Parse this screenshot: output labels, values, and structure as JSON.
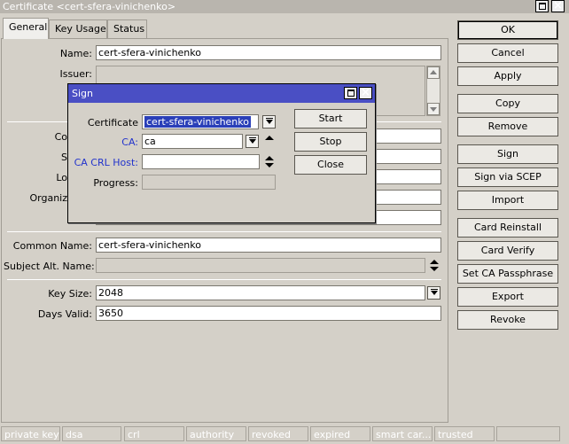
{
  "window": {
    "title": "Certificate <cert-sfera-vinichenko>"
  },
  "tabs": [
    {
      "label": "General",
      "active": true
    },
    {
      "label": "Key Usage",
      "active": false
    },
    {
      "label": "Status",
      "active": false
    }
  ],
  "form": {
    "name_label": "Name:",
    "name_value": "cert-sfera-vinichenko",
    "issuer_label": "Issuer:",
    "country_label": "Co",
    "state_label": "S",
    "locality_label": "Lo",
    "organization_label": "Organiz",
    "common_name_label": "Common Name:",
    "common_name_value": "cert-sfera-vinichenko",
    "subject_alt_label": "Subject Alt. Name:",
    "key_size_label": "Key Size:",
    "key_size_value": "2048",
    "days_valid_label": "Days Valid:",
    "days_valid_value": "3650"
  },
  "buttons": [
    "OK",
    "Cancel",
    "Apply",
    "Copy",
    "Remove",
    "Sign",
    "Sign via SCEP",
    "Import",
    "Card Reinstall",
    "Card Verify",
    "Set CA Passphrase",
    "Export",
    "Revoke"
  ],
  "status_flags": [
    "private key",
    "dsa",
    "crl",
    "authority",
    "revoked",
    "expired",
    "smart car...",
    "trusted",
    ""
  ],
  "sign_dialog": {
    "title": "Sign",
    "certificate_label": "Certificate",
    "certificate_value": "cert-sfera-vinichenko",
    "ca_label": "CA:",
    "ca_value": "ca",
    "ca_crl_host_label": "CA CRL Host:",
    "ca_crl_host_value": "",
    "progress_label": "Progress:",
    "start_label": "Start",
    "stop_label": "Stop",
    "close_label": "Close"
  },
  "colors": {
    "dialog_title_bg": "#4a4fc4",
    "blue_label": "#2233cc",
    "window_bg": "#d4d0c8"
  }
}
